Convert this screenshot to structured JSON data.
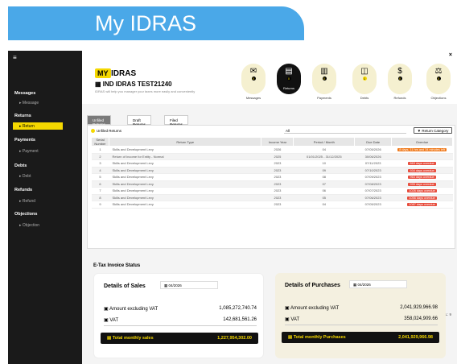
{
  "banner": {
    "title": "My IDRAS"
  },
  "sidebar": {
    "menu_icon": "≡",
    "sections": [
      {
        "label": "Messages",
        "items": [
          "Message"
        ]
      },
      {
        "label": "Returns",
        "items": [
          "Return"
        ]
      },
      {
        "label": "Payments",
        "items": [
          "Payment"
        ]
      },
      {
        "label": "Debts",
        "items": [
          "Debt"
        ]
      },
      {
        "label": "Refunds",
        "items": [
          "Refund"
        ]
      },
      {
        "label": "Objections",
        "items": [
          "Objection"
        ]
      }
    ]
  },
  "header": {
    "logo": "MY",
    "logo_text": "IDRAS",
    "company": "IND IDRAS TEST21240",
    "desc": "IDRAS will help you manager your taxes more easily and conveniently",
    "close": "×"
  },
  "nav": [
    {
      "label": "Messages",
      "icon": "✉",
      "count": "0"
    },
    {
      "label": "Returns",
      "icon": "▤",
      "count": "0"
    },
    {
      "label": "Payments",
      "icon": "▥",
      "count": "0"
    },
    {
      "label": "Debts",
      "icon": "◫",
      "count": "1"
    },
    {
      "label": "Refunds",
      "icon": "$",
      "count": "0"
    },
    {
      "label": "Objections",
      "icon": "⚖",
      "count": "0"
    }
  ],
  "tabs": [
    "Unfiled Returns",
    "Draft Returns",
    "Filed Returns"
  ],
  "filter": {
    "label": "Unfiled Returns",
    "select": "All",
    "button": "Return Category"
  },
  "table": {
    "headers": [
      "Serial Number",
      "Return Type",
      "Income Year",
      "Period / Month",
      "Due Date",
      "Overdue"
    ],
    "rows": [
      [
        "1",
        "Skills and Development Levy",
        "2026",
        "04",
        "07/05/2026",
        "8 days, 11 hrs and 34 minutes left"
      ],
      [
        "2",
        "Return of Income for Entity - Normal",
        "2025",
        "01/01/2025 - 31/12/2025",
        "30/06/2026",
        ""
      ],
      [
        "3",
        "Skills and Development Levy",
        "2023",
        "10",
        "07/11/2023",
        "863 days overdue"
      ],
      [
        "4",
        "Skills and Development Levy",
        "2023",
        "09",
        "07/10/2023",
        "934 days overdue"
      ],
      [
        "5",
        "Skills and Development Levy",
        "2023",
        "08",
        "07/09/2023",
        "964 days overdue"
      ],
      [
        "6",
        "Skills and Development Levy",
        "2023",
        "07",
        "07/08/2023",
        "995 days overdue"
      ],
      [
        "7",
        "Skills and Development Levy",
        "2023",
        "06",
        "07/07/2023",
        "1026 days overdue"
      ],
      [
        "8",
        "Skills and Development Levy",
        "2023",
        "05",
        "07/06/2023",
        "1056 days overdue"
      ],
      [
        "9",
        "Skills and Development Levy",
        "2023",
        "04",
        "07/05/2023",
        "1087 days overdue"
      ]
    ],
    "total": "TOTAL: 9"
  },
  "etax": {
    "title": "E-Tax Invoice Status",
    "sales": {
      "title": "Details of Sales",
      "date": "04/2026",
      "excl_label": "Amount excluding VAT",
      "excl": "1,085,272,740.74",
      "vat_label": "VAT",
      "vat": "142,681,561.26",
      "total_label": "Total monthly sales",
      "total": "1,227,954,302.00"
    },
    "purchases": {
      "title": "Details of Purchases",
      "date": "04/2026",
      "excl_label": "Amount excluding VAT",
      "excl": "2,041,929,966.98",
      "vat_label": "VAT",
      "vat": "358,024,909.66",
      "total_label": "Total monthly Purchases",
      "total": "2,041,929,966.98"
    }
  }
}
